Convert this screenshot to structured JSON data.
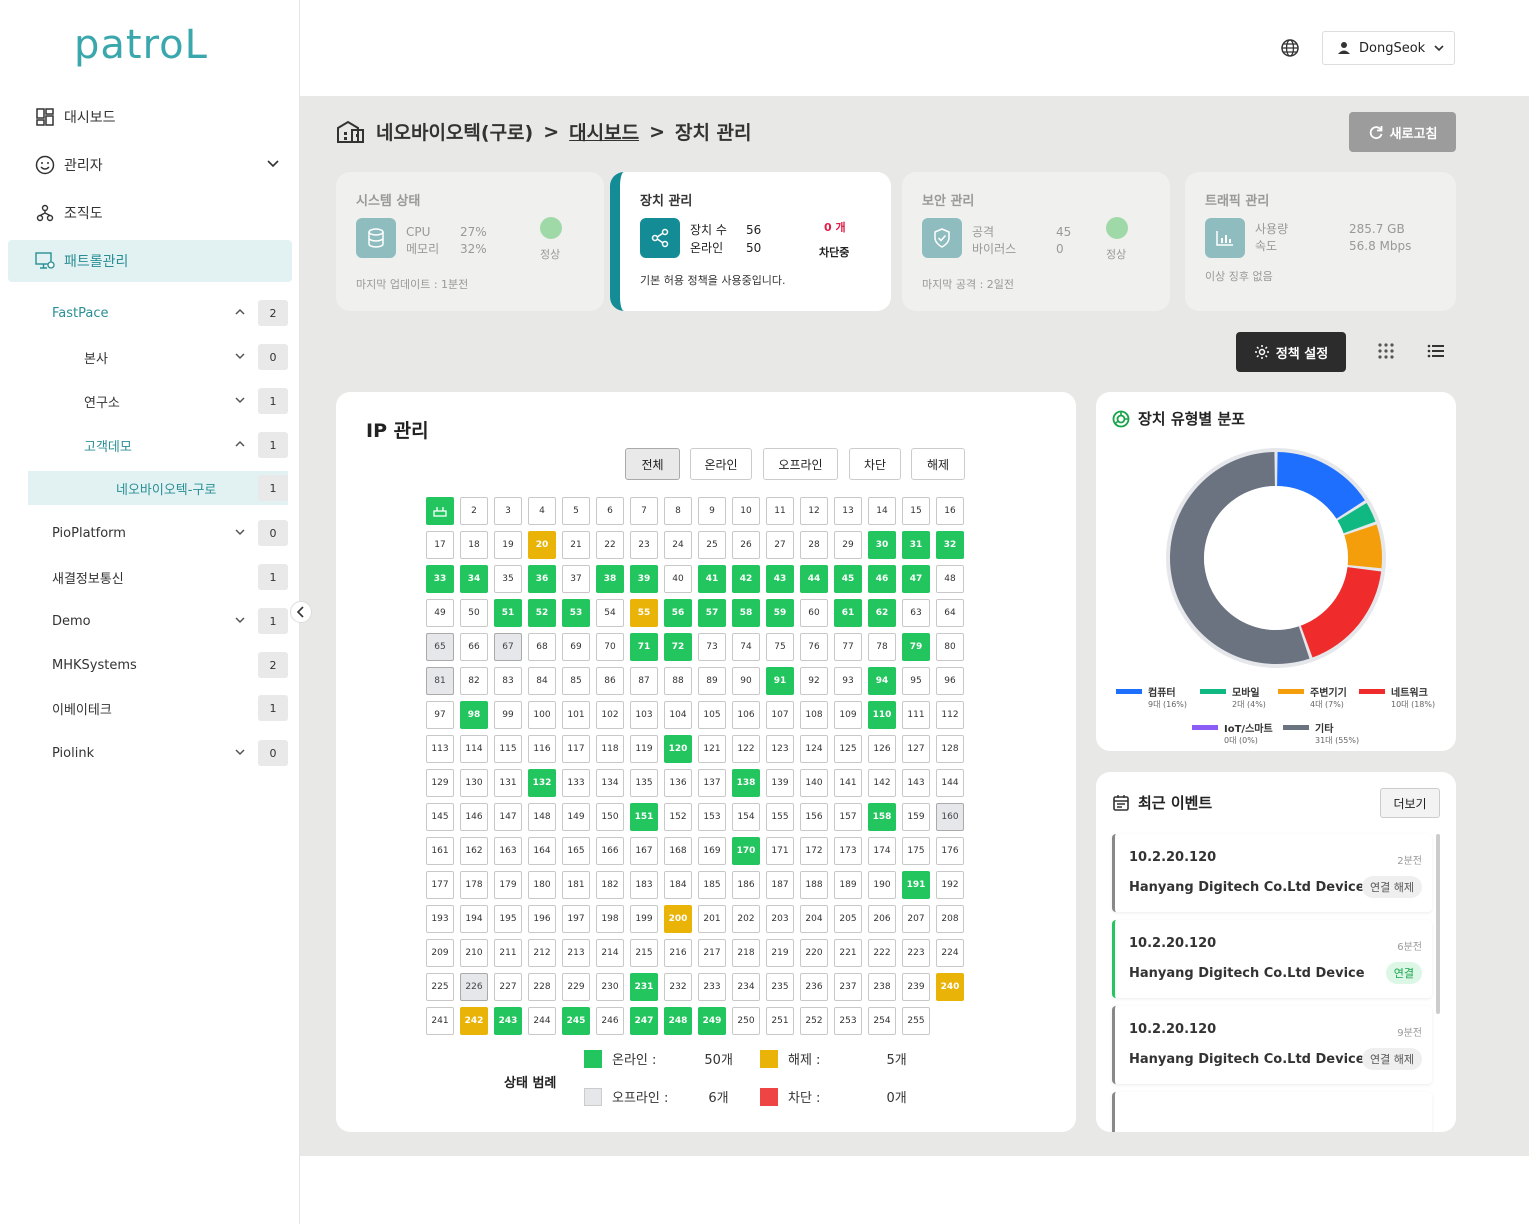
{
  "logo": "patroL",
  "nav": [
    {
      "label": "대시보드",
      "icon": "dashboard-icon"
    },
    {
      "label": "관리자",
      "icon": "smile-icon"
    },
    {
      "label": "조직도",
      "icon": "org-icon"
    },
    {
      "label": "패트롤관리",
      "icon": "patrol-icon"
    }
  ],
  "tree": [
    {
      "label": "FastPace",
      "count": "2"
    },
    {
      "label": "본사",
      "count": "0"
    },
    {
      "label": "연구소",
      "count": "1"
    },
    {
      "label": "고객데모",
      "count": "1"
    },
    {
      "label": "네오바이오텍-구로",
      "count": "1"
    },
    {
      "label": "PioPlatform",
      "count": "0"
    },
    {
      "label": "새결정보통신",
      "count": "1"
    },
    {
      "label": "Demo",
      "count": "1"
    },
    {
      "label": "MHKSystems",
      "count": "2"
    },
    {
      "label": "이베이테크",
      "count": "1"
    },
    {
      "label": "Piolink",
      "count": "0"
    }
  ],
  "user": "DongSeok",
  "breadcrumb": {
    "site": "네오바이오텍(구로)",
    "sep": ">",
    "parent": "대시보드",
    "current": "장치 관리"
  },
  "refresh_label": "새로고침",
  "cards": {
    "system": {
      "title": "시스템 상태",
      "l1": "CPU",
      "l2": "메모리",
      "v1": "27%",
      "v2": "32%",
      "status": "정상",
      "foot": "마지막 업데이트 : 1분전"
    },
    "device": {
      "title": "장치 관리",
      "l1": "장치 수",
      "l2": "온라인",
      "v1": "56",
      "v2": "50",
      "block_count": "0 개",
      "block_label": "차단중",
      "foot": "기본 허용 정책을 사용중입니다."
    },
    "security": {
      "title": "보안 관리",
      "l1": "공격",
      "l2": "바이러스",
      "v1": "45",
      "v2": "0",
      "status": "정상",
      "foot": "마지막 공격 : 2일전"
    },
    "traffic": {
      "title": "트래픽 관리",
      "l1": "사용량",
      "l2": "속도",
      "v1": "285.7 GB",
      "v2": "56.8 Mbps",
      "foot": "이상 징후 없음"
    }
  },
  "policy_label": "정책 설정",
  "ip": {
    "title": "IP 관리",
    "filters": [
      "전체",
      "온라인",
      "오프라인",
      "차단",
      "해제"
    ],
    "online": [
      1,
      30,
      31,
      32,
      33,
      34,
      36,
      38,
      39,
      41,
      42,
      43,
      44,
      45,
      46,
      47,
      51,
      52,
      53,
      56,
      57,
      58,
      59,
      61,
      62,
      71,
      72,
      79,
      91,
      94,
      98,
      110,
      120,
      132,
      138,
      151,
      158,
      170,
      191,
      231,
      243,
      245,
      247,
      248,
      249
    ],
    "released": [
      20,
      55,
      200,
      240,
      242
    ],
    "offline": [
      65,
      67,
      81,
      160,
      226
    ],
    "legend_title": "상태 범례",
    "legend": [
      {
        "label": "온라인 :",
        "count": "50개",
        "color": "#22c55e"
      },
      {
        "label": "해제 :",
        "count": "5개",
        "color": "#eab308"
      },
      {
        "label": "오프라인 :",
        "count": "6개",
        "color": "#e5e7eb"
      },
      {
        "label": "차단 :",
        "count": "0개",
        "color": "#ef4444"
      }
    ]
  },
  "chart_data": {
    "type": "pie",
    "title": "장치 유형별 분포",
    "categories": [
      "컴퓨터",
      "모바일",
      "주변기기",
      "네트워크",
      "IoT/스마트",
      "기타"
    ],
    "values": [
      9,
      2,
      4,
      10,
      0,
      31
    ],
    "labels": [
      "9대 (16%)",
      "2대 (4%)",
      "4대 (7%)",
      "10대 (18%)",
      "0대 (0%)",
      "31대 (55%)"
    ],
    "colors": [
      "#1f6fff",
      "#10b981",
      "#f59e0b",
      "#ef2b2b",
      "#8b5cf6",
      "#6b7280"
    ]
  },
  "events": {
    "title": "최근 이벤트",
    "more": "더보기",
    "items": [
      {
        "ip": "10.2.20.120",
        "time": "2분전",
        "device": "Hanyang Digitech Co.Ltd Device",
        "status": "연결 해제"
      },
      {
        "ip": "10.2.20.120",
        "time": "6분전",
        "device": "Hanyang Digitech Co.Ltd Device",
        "status": "연결"
      },
      {
        "ip": "10.2.20.120",
        "time": "9분전",
        "device": "Hanyang Digitech Co.Ltd Device",
        "status": "연결 해제"
      }
    ]
  }
}
